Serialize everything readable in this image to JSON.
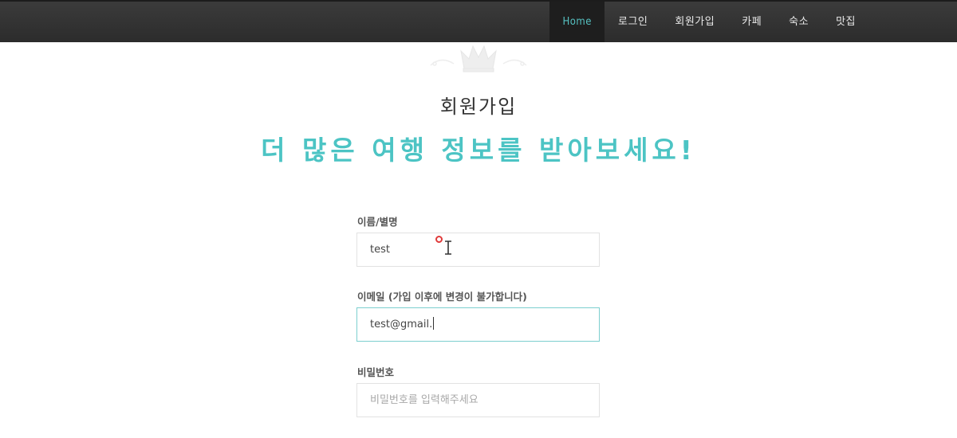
{
  "nav": {
    "items": [
      {
        "label": "Home",
        "active": true
      },
      {
        "label": "로그인",
        "active": false
      },
      {
        "label": "회원가입",
        "active": false
      },
      {
        "label": "카페",
        "active": false
      },
      {
        "label": "숙소",
        "active": false
      },
      {
        "label": "맛집",
        "active": false
      }
    ],
    "active_color": "#56c2c2"
  },
  "hero": {
    "title": "회원가입",
    "headline": "더 많은 여행 정보를 받아보세요!",
    "accent_color": "#4cc4c4",
    "decoration_icon": "crown-icon"
  },
  "form": {
    "name": {
      "label": "이름/별명",
      "value": "test"
    },
    "email": {
      "label": "이메일 (가입 이후에 변경이 불가합니다)",
      "value": "test@gmail."
    },
    "password": {
      "label": "비밀번호",
      "placeholder": "비밀번호를 입력해주세요"
    }
  }
}
